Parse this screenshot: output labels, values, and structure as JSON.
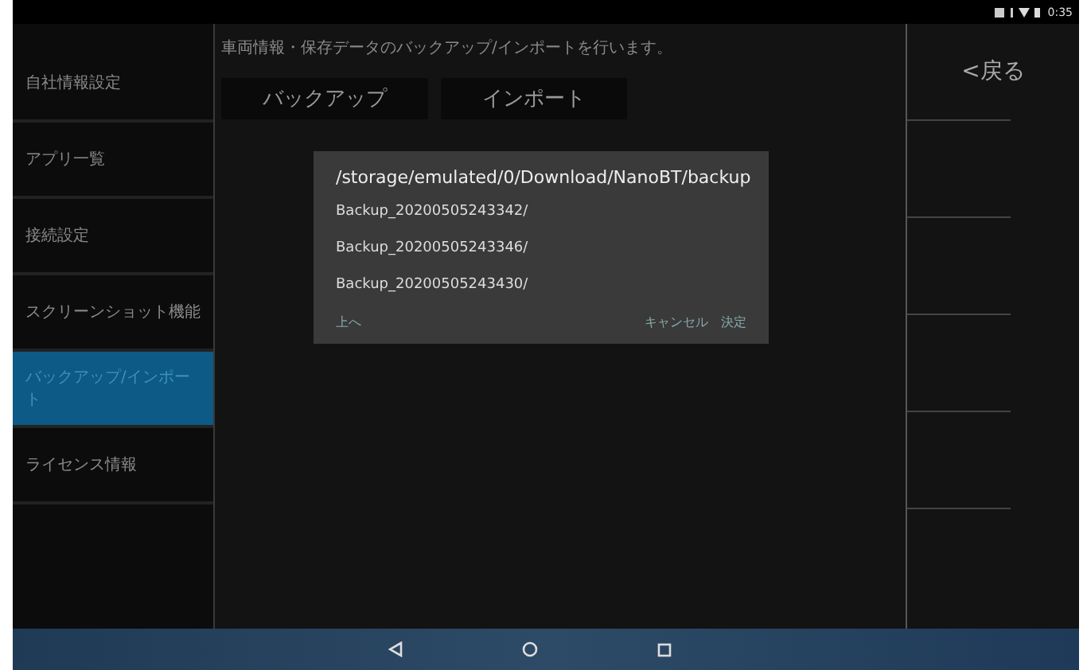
{
  "status_bar": {
    "time": "0:35"
  },
  "sidebar": {
    "items": [
      {
        "label": "自社情報設定",
        "selected": false
      },
      {
        "label": "アプリ一覧",
        "selected": false
      },
      {
        "label": "接続設定",
        "selected": false
      },
      {
        "label": "スクリーンショット機能",
        "selected": false
      },
      {
        "label": "バックアップ/インポート",
        "selected": true
      },
      {
        "label": "ライセンス情報",
        "selected": false
      }
    ]
  },
  "description": "車両情報・保存データのバックアップ/インポートを行います。",
  "buttons": [
    "バックアップ",
    "インポート"
  ],
  "back_button": "<戻る",
  "dialog": {
    "title": "/storage/emulated/0/Download/NanoBT/backup",
    "items": [
      "Backup_20200505243342/",
      "Backup_20200505243346/",
      "Backup_20200505243430/"
    ],
    "up_button": "上へ",
    "cancel_button": "キャンセル",
    "ok_button": "決定"
  }
}
